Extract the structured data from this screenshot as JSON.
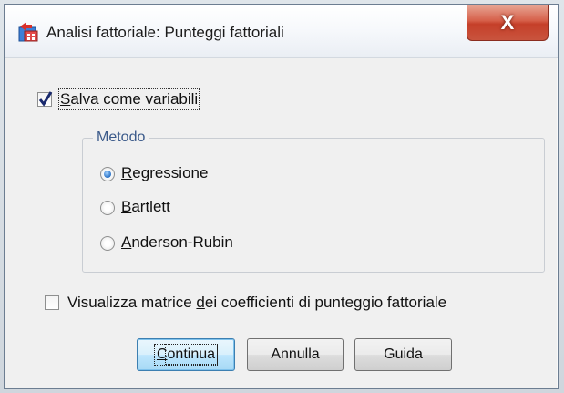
{
  "dialog": {
    "title": "Analisi fattoriale: Punteggi fattoriali",
    "close_label": "X"
  },
  "save_as_variables": {
    "label_pre": "",
    "label_key": "S",
    "label_post": "alva come variabili",
    "checked": true
  },
  "method_group": {
    "title": "Metodo",
    "options": [
      {
        "key": "R",
        "rest": "egressione",
        "selected": true
      },
      {
        "key": "B",
        "rest": "artlett",
        "selected": false
      },
      {
        "key": "A",
        "rest": "nderson-Rubin",
        "selected": false
      }
    ]
  },
  "display_matrix": {
    "label_pre": "Visualizza matrice ",
    "label_key": "d",
    "label_post": "ei coefficienti di punteggio fattoriale",
    "checked": false
  },
  "buttons": {
    "continue": {
      "key": "C",
      "rest": "ontinua"
    },
    "cancel": "Annulla",
    "help": "Guida"
  },
  "colors": {
    "group_title": "#3b5a8a",
    "close_button": "#c53f29",
    "default_button": "#bee6fd"
  }
}
